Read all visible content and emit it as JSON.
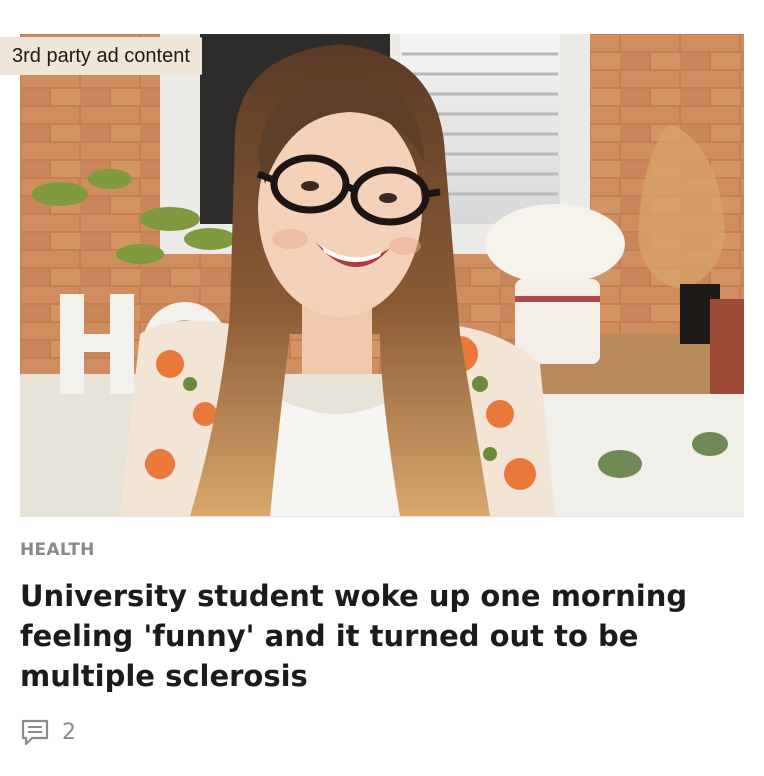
{
  "ad": {
    "badge_label": "3rd party ad content"
  },
  "article": {
    "category": "HEALTH",
    "headline": "University student woke up one morning feeling 'funny' and it turned out to be multiple sclerosis",
    "image_alt": "Woman with long hair and glasses smiling in a kitchen",
    "comment_count": "2",
    "comment_icon": "comment-icon"
  },
  "colors": {
    "category": "#8a8a8a",
    "headline": "#1b1b1b",
    "badge_bg": "#efe6d8"
  }
}
